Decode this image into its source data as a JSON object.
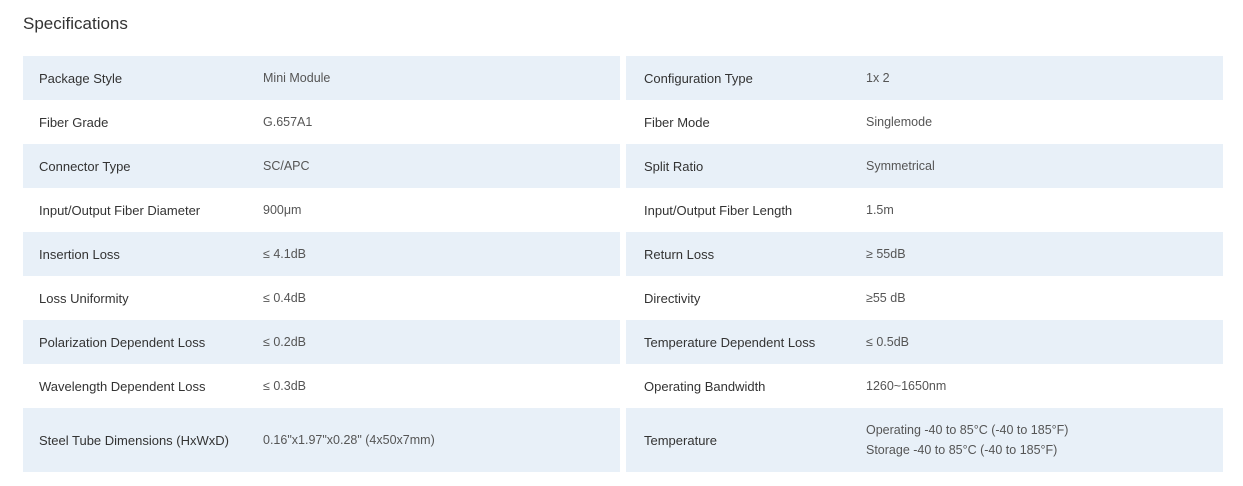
{
  "title": "Specifications",
  "rows": [
    {
      "l_label": "Package Style",
      "l_value": "Mini Module",
      "r_label": "Configuration Type",
      "r_value": "1x 2"
    },
    {
      "l_label": "Fiber Grade",
      "l_value": "G.657A1",
      "r_label": "Fiber Mode",
      "r_value": "Singlemode"
    },
    {
      "l_label": "Connector Type",
      "l_value": "SC/APC",
      "r_label": "Split Ratio",
      "r_value": "Symmetrical"
    },
    {
      "l_label": "Input/Output Fiber Diameter",
      "l_value": "900μm",
      "r_label": "Input/Output Fiber Length",
      "r_value": "1.5m"
    },
    {
      "l_label": "Insertion Loss",
      "l_value": "≤ 4.1dB",
      "r_label": "Return Loss",
      "r_value": "≥ 55dB"
    },
    {
      "l_label": "Loss Uniformity",
      "l_value": "≤ 0.4dB",
      "r_label": "Directivity",
      "r_value": "≥55 dB"
    },
    {
      "l_label": "Polarization Dependent Loss",
      "l_value": "≤ 0.2dB",
      "r_label": "Temperature Dependent Loss",
      "r_value": "≤ 0.5dB"
    },
    {
      "l_label": "Wavelength Dependent Loss",
      "l_value": "≤ 0.3dB",
      "r_label": "Operating Bandwidth",
      "r_value": "1260~1650nm"
    },
    {
      "l_label": "Steel Tube Dimensions (HxWxD)",
      "l_value": "0.16\"x1.97\"x0.28\" (4x50x7mm)",
      "r_label": "Temperature",
      "r_value_lines": [
        "Operating -40 to 85°C (-40 to 185°F)",
        "Storage -40 to 85°C (-40 to 185°F)"
      ]
    }
  ],
  "colors": {
    "row_shade": "#e8f0f8",
    "text": "#333333",
    "value_text": "#555555"
  }
}
